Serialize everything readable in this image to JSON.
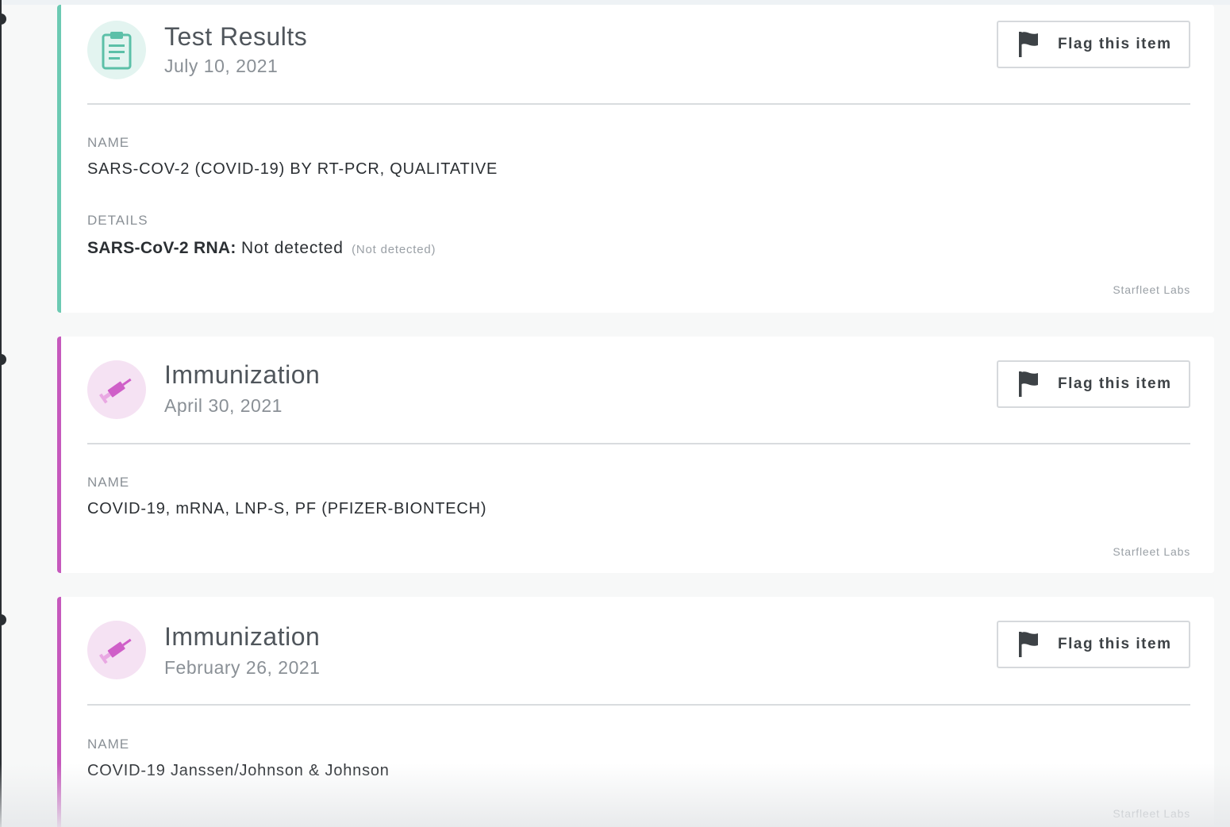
{
  "flag_label": "Flag this item",
  "colors": {
    "test_accent": "#6ccab3",
    "immunization_accent": "#c659bd"
  },
  "icons": {
    "flag": "flag-icon",
    "test": "clipboard-icon",
    "immunization": "syringe-icon"
  },
  "cards": [
    {
      "title": "Test Results",
      "date": "July 10, 2021",
      "name_label": "NAME",
      "name_value": "SARS-COV-2 (COVID-19) BY RT-PCR, QUALITATIVE",
      "details_label": "DETAILS",
      "detail_key": "SARS-CoV-2 RNA:",
      "detail_value": "Not detected",
      "detail_reference": "(Not detected)",
      "source": "Starfleet Labs"
    },
    {
      "title": "Immunization",
      "date": "April 30, 2021",
      "name_label": "NAME",
      "name_value": "COVID-19, mRNA, LNP-S, PF (PFIZER-BIONTECH)",
      "source": "Starfleet Labs"
    },
    {
      "title": "Immunization",
      "date": "February 26, 2021",
      "name_label": "NAME",
      "name_value": "COVID-19 Janssen/Johnson & Johnson",
      "source": "Starfleet Labs"
    }
  ]
}
